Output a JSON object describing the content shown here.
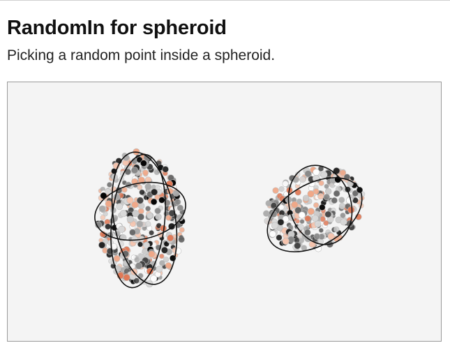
{
  "demo": {
    "title": "RandomIn for spheroid",
    "description": "Picking a random point inside a spheroid."
  },
  "scene": {
    "background_color": "#f4f4f4",
    "outline_color": "#111111",
    "point_colors": [
      "#000000",
      "#222222",
      "#444444",
      "#666666",
      "#888888",
      "#aaaaaa",
      "#cccccc",
      "#ffffff",
      "#e07a58",
      "#f0a888",
      "#f5c4ae",
      "#d9d9d9"
    ],
    "spheroids": [
      {
        "kind": "prolate",
        "point_count": 420
      },
      {
        "kind": "oblate",
        "point_count": 300
      }
    ]
  }
}
